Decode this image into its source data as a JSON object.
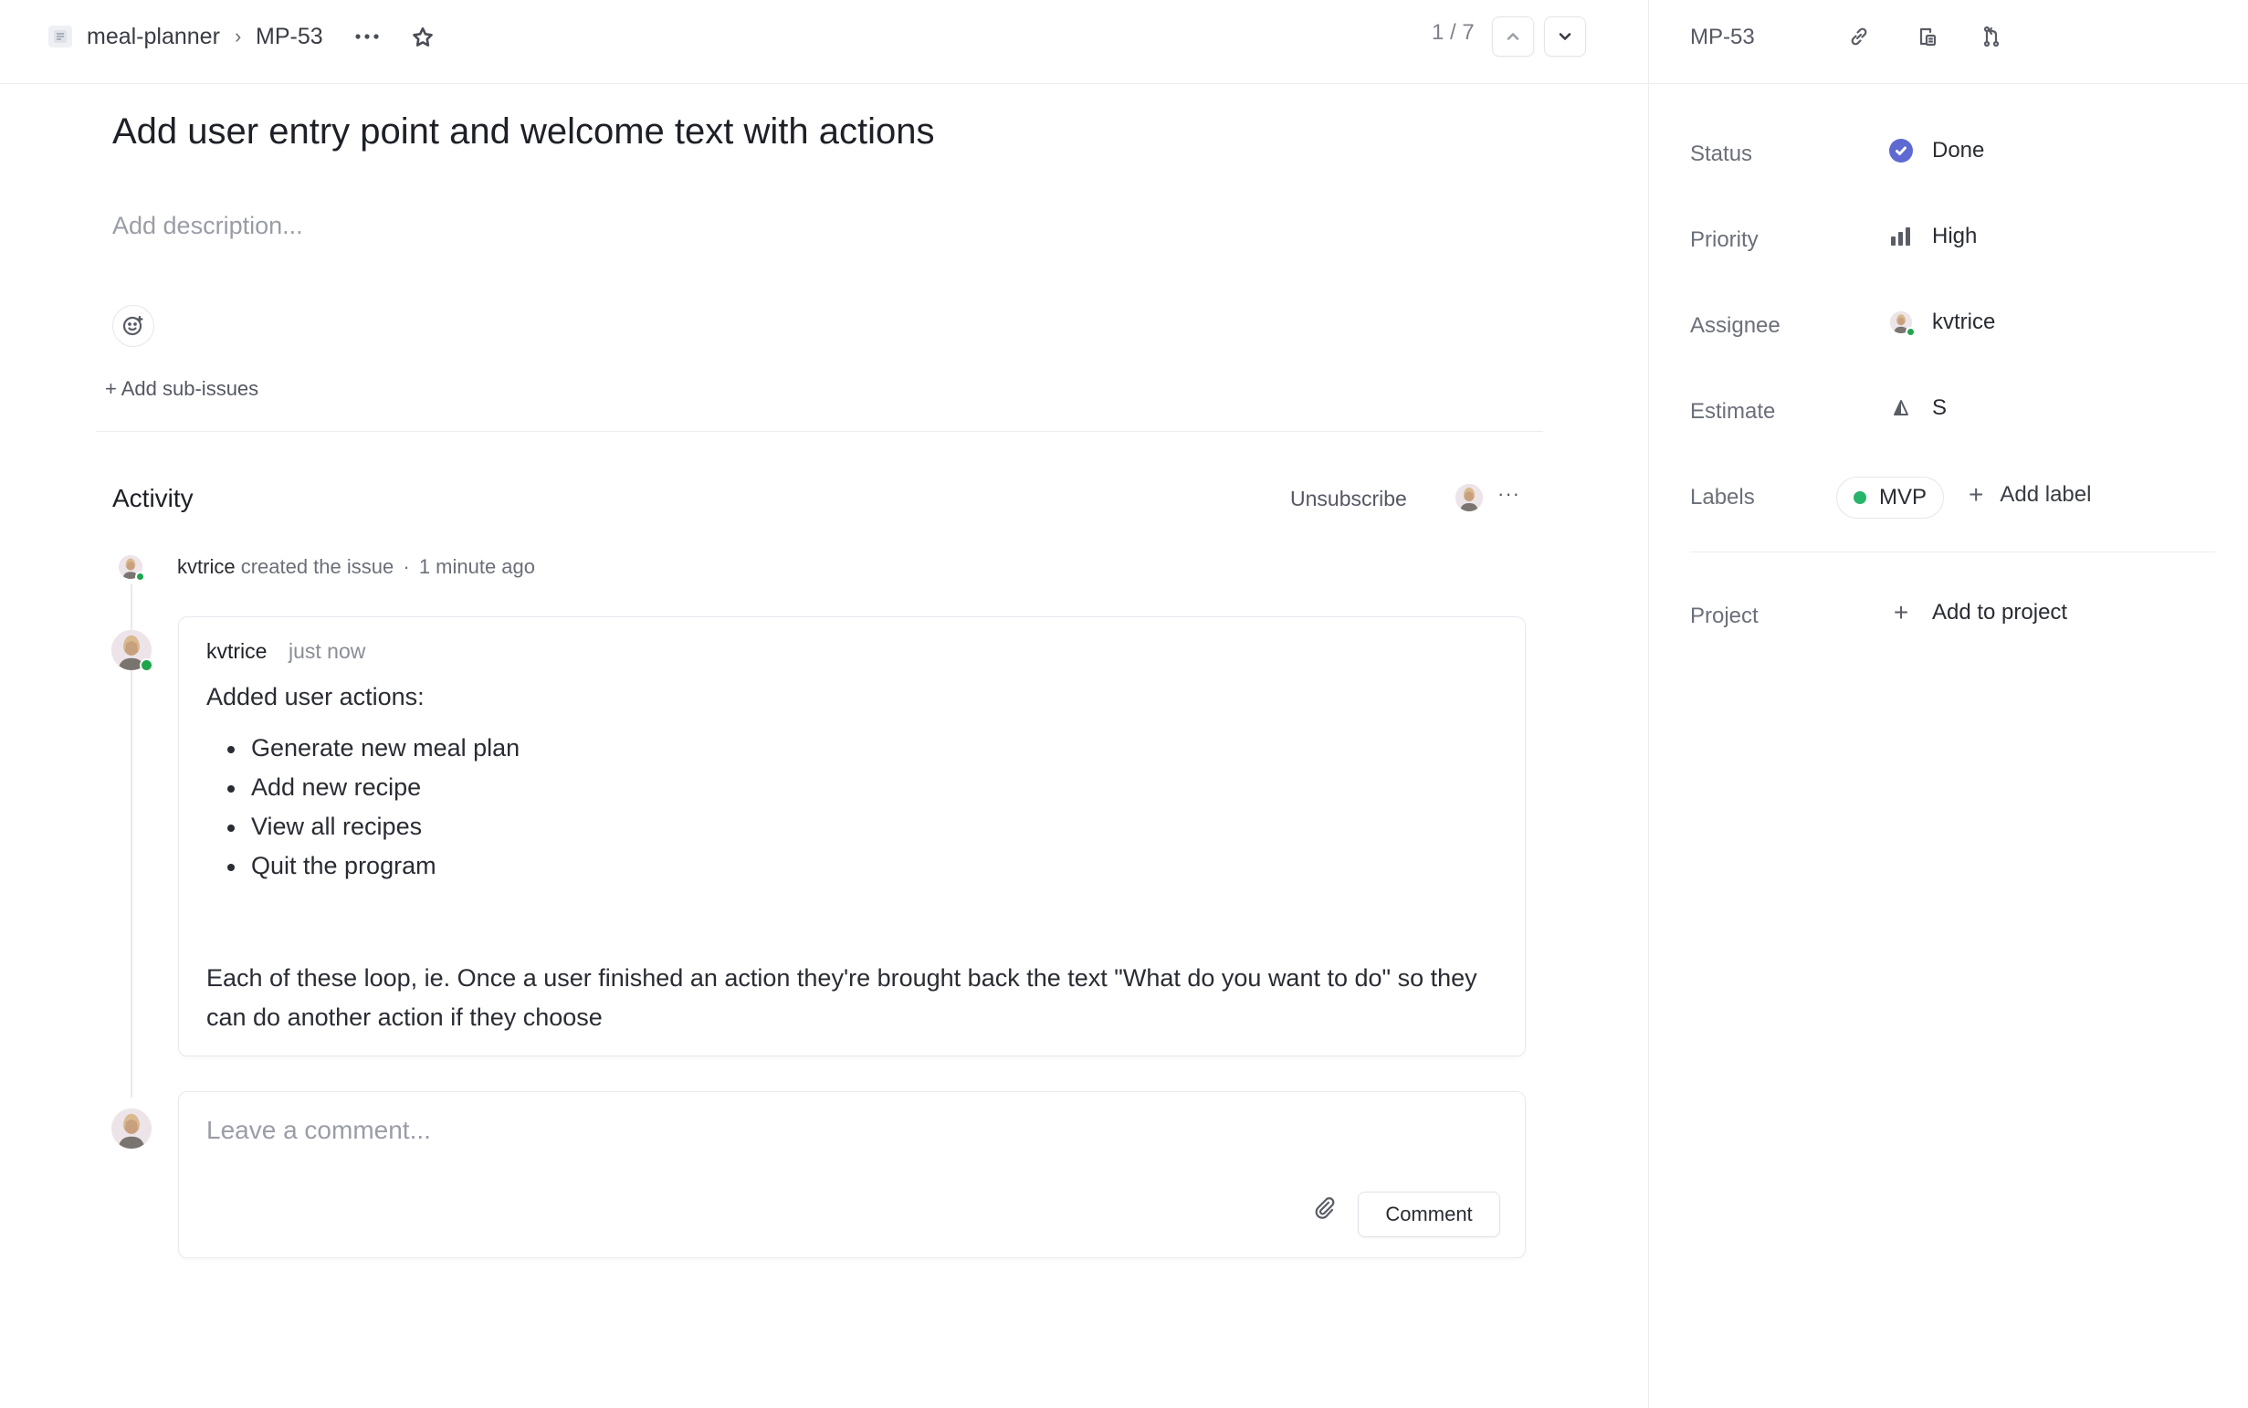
{
  "breadcrumb": {
    "project": "meal-planner",
    "separator": "›",
    "issue_id": "MP-53"
  },
  "pager": {
    "text": "1 / 7"
  },
  "issue": {
    "title": "Add user entry point and welcome text with actions",
    "description_placeholder": "Add description...",
    "add_sub_issues": "+ Add sub-issues"
  },
  "activity": {
    "title": "Activity",
    "unsubscribe": "Unsubscribe",
    "more": "···",
    "event": {
      "user": "kvtrice",
      "action": "created the issue",
      "separator": "·",
      "time": "1 minute ago"
    },
    "comment": {
      "author": "kvtrice",
      "time": "just now",
      "intro": "Added user actions:",
      "items": [
        "Generate new meal plan",
        "Add new recipe",
        "View all recipes",
        "Quit the program"
      ],
      "paragraph": "Each of these loop, ie. Once a user finished an action they're brought back the text \"What do you want to do\" so they can do another action if they choose"
    },
    "reply": {
      "placeholder": "Leave a comment...",
      "submit_label": "Comment"
    }
  },
  "sidebar": {
    "issue_id": "MP-53",
    "properties": {
      "status": {
        "label": "Status",
        "value": "Done"
      },
      "priority": {
        "label": "Priority",
        "value": "High"
      },
      "assignee": {
        "label": "Assignee",
        "value": "kvtrice"
      },
      "estimate": {
        "label": "Estimate",
        "value": "S"
      },
      "labels": {
        "label": "Labels",
        "value": "MVP",
        "add": "Add label"
      },
      "project": {
        "label": "Project",
        "value": "Add to project"
      }
    }
  },
  "colors": {
    "status_done": "#5e6ad2",
    "label_mvp": "#26b56a",
    "online": "#1ea64c"
  },
  "icons": [
    "project-icon",
    "more-icon",
    "star-icon",
    "chevron-up-icon",
    "chevron-down-icon",
    "emoji-add-icon",
    "link-icon",
    "copy-branch-icon",
    "git-branch-icon",
    "check-icon",
    "priority-bars-icon",
    "estimate-icon",
    "plus-icon",
    "paperclip-icon"
  ]
}
